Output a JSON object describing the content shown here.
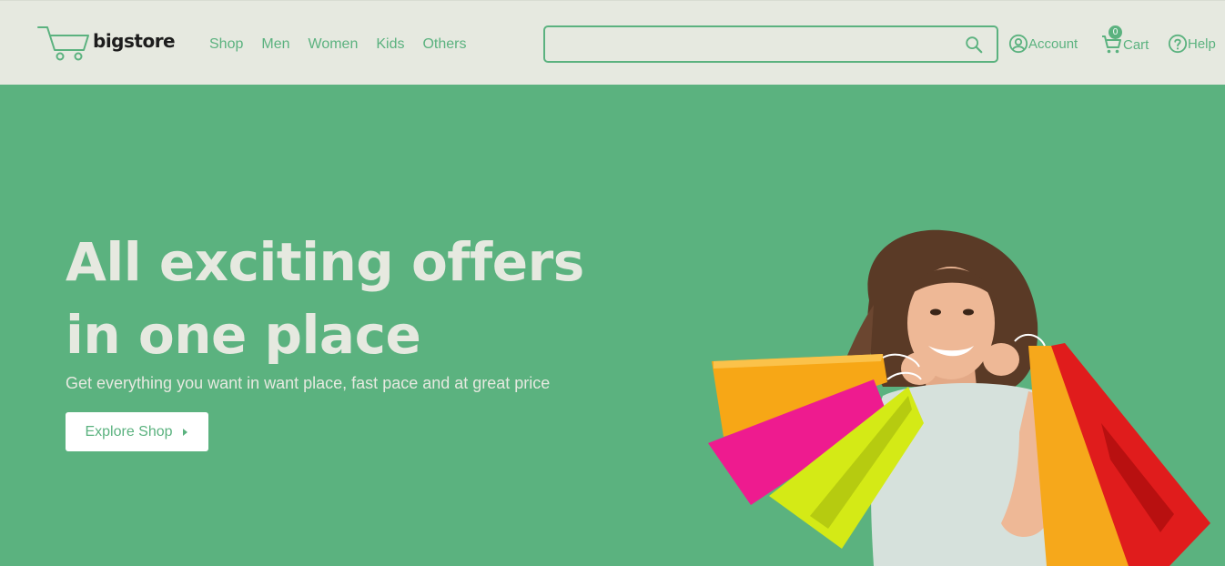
{
  "brand": {
    "name": "bigstore"
  },
  "nav": {
    "items": [
      {
        "label": "Shop"
      },
      {
        "label": "Men"
      },
      {
        "label": "Women"
      },
      {
        "label": "Kids"
      },
      {
        "label": "Others"
      }
    ]
  },
  "search": {
    "value": "",
    "placeholder": ""
  },
  "header_links": {
    "account": "Account",
    "cart": "Cart",
    "cart_count": "0",
    "help": "Help"
  },
  "hero": {
    "title": "All exciting offers in one place",
    "subtitle": "Get everything you want in want place, fast pace and at great price",
    "button_label": "Explore Shop"
  },
  "icons": {
    "logo": "cart-logo-icon",
    "search": "search-icon",
    "account": "account-circle-icon",
    "cart": "cart-icon",
    "help": "help-circle-icon",
    "button_arrow": "caret-right-icon"
  },
  "colors": {
    "accent": "#5bb27f",
    "header_bg": "#e6e9e0",
    "hero_text": "#e6e9e0",
    "button_bg": "#ffffff"
  }
}
